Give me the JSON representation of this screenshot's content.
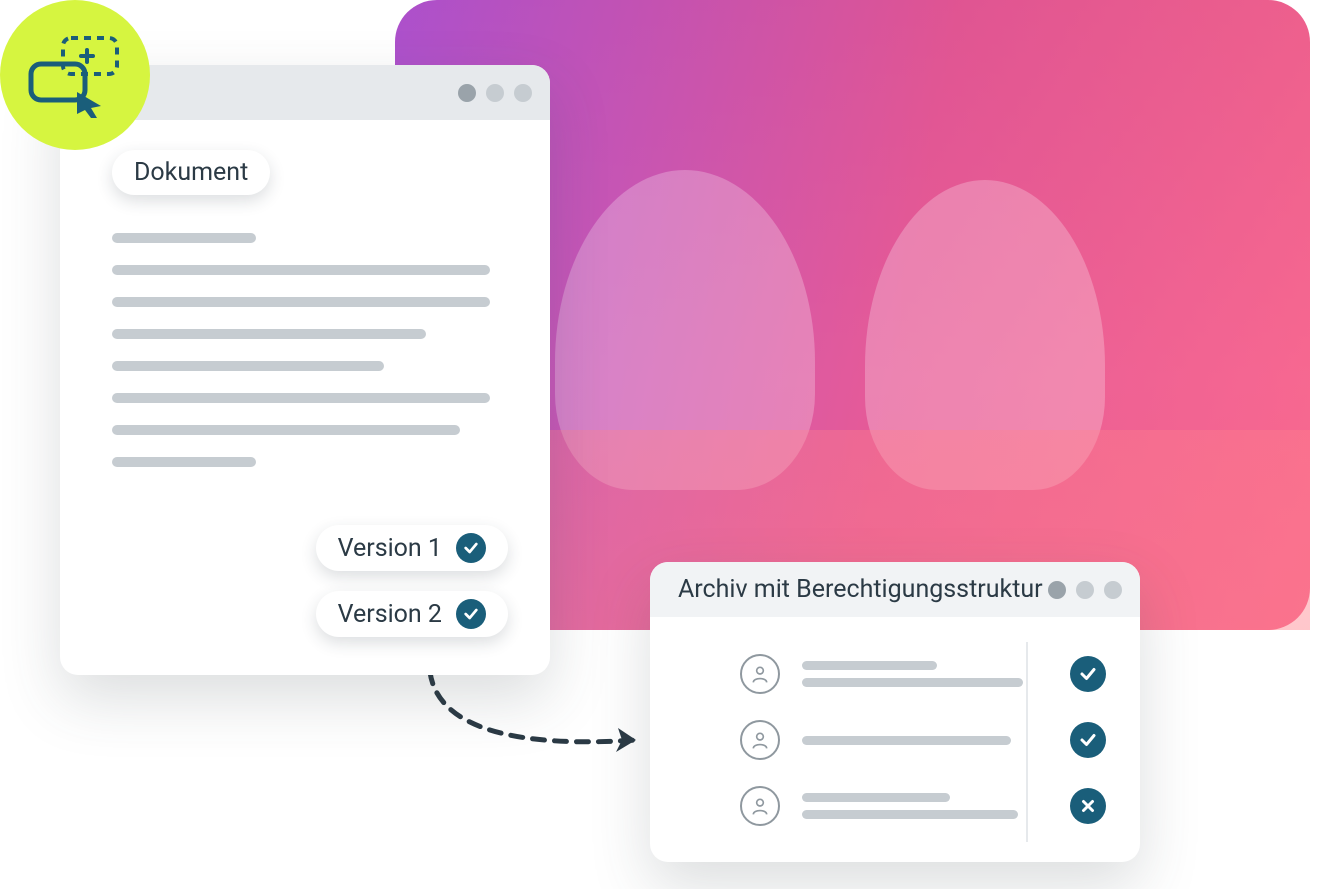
{
  "document_card": {
    "chip_label": "Dokument",
    "versions": [
      {
        "label": "Version 1",
        "status": "check"
      },
      {
        "label": "Version 2",
        "status": "check"
      }
    ]
  },
  "archive_card": {
    "title": "Archiv mit Berechtigungsstruktur",
    "rows": [
      {
        "status": "allow"
      },
      {
        "status": "allow"
      },
      {
        "status": "deny"
      }
    ]
  },
  "colors": {
    "accent_badge": "#d6f540",
    "status_circle": "#1a5e7a"
  }
}
